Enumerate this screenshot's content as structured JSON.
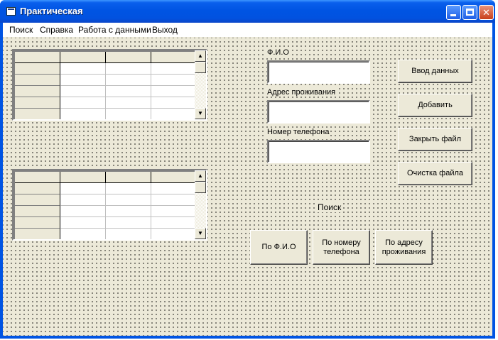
{
  "window": {
    "title": "Практическая"
  },
  "menu": [
    {
      "label": "Поиск"
    },
    {
      "label": "Справка"
    },
    {
      "label": "Работа с данными"
    },
    {
      "label": "Выход"
    }
  ],
  "fields": {
    "fio_label": "Ф.И.О",
    "fio_value": "",
    "address_label": "Адрес проживания",
    "address_value": "",
    "phone_label": "Номер телефона",
    "phone_value": ""
  },
  "actions": {
    "input_data": "Ввод данных",
    "add": "Добавить",
    "close_file": "Закрыть файл",
    "clear_file": "Очистка файла"
  },
  "search": {
    "label": "Поиск",
    "by_fio": "По Ф.И.О",
    "by_phone": "По номеру\nтелефона",
    "by_address": "По адресу\nпроживания"
  },
  "grids": [
    {
      "name": "grid-top",
      "columns": 4,
      "rows": 6
    },
    {
      "name": "grid-bottom",
      "columns": 4,
      "rows": 6
    }
  ],
  "icons": {
    "scroll_up": "▲",
    "scroll_down": "▼",
    "close": "✕"
  }
}
